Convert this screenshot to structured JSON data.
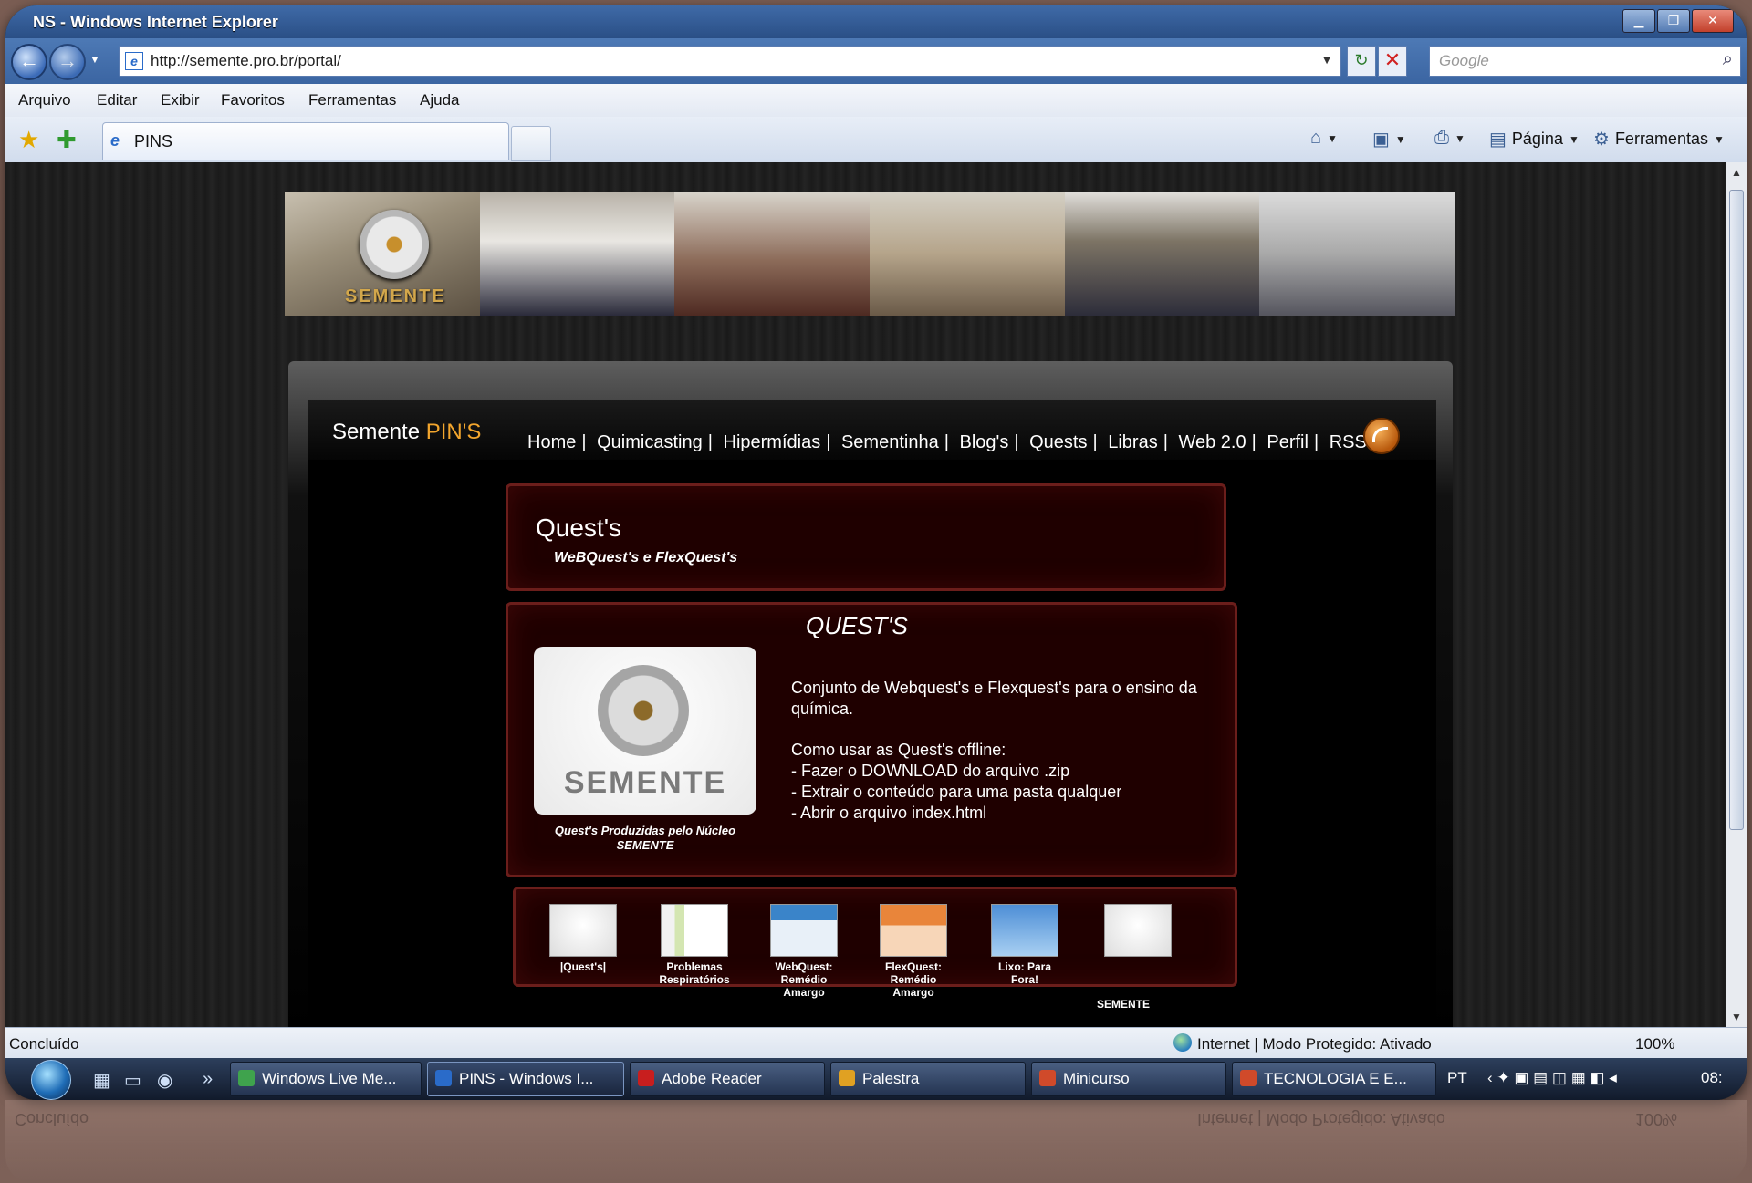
{
  "window": {
    "title": "NS - Windows Internet Explorer"
  },
  "address": {
    "url": "http://semente.pro.br/portal/",
    "search_placeholder": "Google"
  },
  "menu": [
    "Arquivo",
    "Editar",
    "Exibir",
    "Favoritos",
    "Ferramentas",
    "Ajuda"
  ],
  "tab": {
    "label": "PINS"
  },
  "commands": {
    "page": "Página",
    "tools": "Ferramentas"
  },
  "banner": {
    "logo_text": "SEMENTE"
  },
  "site": {
    "brand_left": "Semente ",
    "brand_right": "PIN'S",
    "nav": [
      "Home",
      "Quimicasting",
      "Hipermídias",
      "Sementinha",
      "Blog's",
      "Quests",
      "Libras",
      "Web 2.0",
      "Perfil",
      "RSS"
    ]
  },
  "header_box": {
    "title": "Quest's",
    "subtitle": "WeBQuest's e FlexQuest's"
  },
  "content": {
    "heading": "QUEST'S",
    "logo_word": "SEMENTE",
    "logo_caption": "Quest's Produzidas pelo Núcleo SEMENTE",
    "desc1": "Conjunto de Webquest's e Flexquest's para o ensino da química.",
    "how_title": "Como usar as Quest's offline:",
    "steps": [
      "- Fazer o DOWNLOAD do arquivo .zip",
      "- Extrair o conteúdo para uma pasta qualquer",
      "- Abrir o arquivo index.html"
    ]
  },
  "thumbs": [
    {
      "label": "|Quest's|"
    },
    {
      "label": "Problemas Respiratórios"
    },
    {
      "label": "WebQuest: Remédio Amargo"
    },
    {
      "label": "FlexQuest: Remédio Amargo"
    },
    {
      "label": "Lixo: Para Fora!"
    },
    {
      "label": ""
    }
  ],
  "footer_label": "SEMENTE",
  "status": {
    "text": "Concluído",
    "zone": "Internet | Modo Protegido: Ativado",
    "zoom": "100%"
  },
  "taskbar": {
    "items": [
      "Windows Live Me...",
      "PINS - Windows I...",
      "Adobe Reader",
      "Palestra",
      "Minicurso",
      "TECNOLOGIA E E..."
    ],
    "lang": "PT",
    "clock": "08:"
  }
}
